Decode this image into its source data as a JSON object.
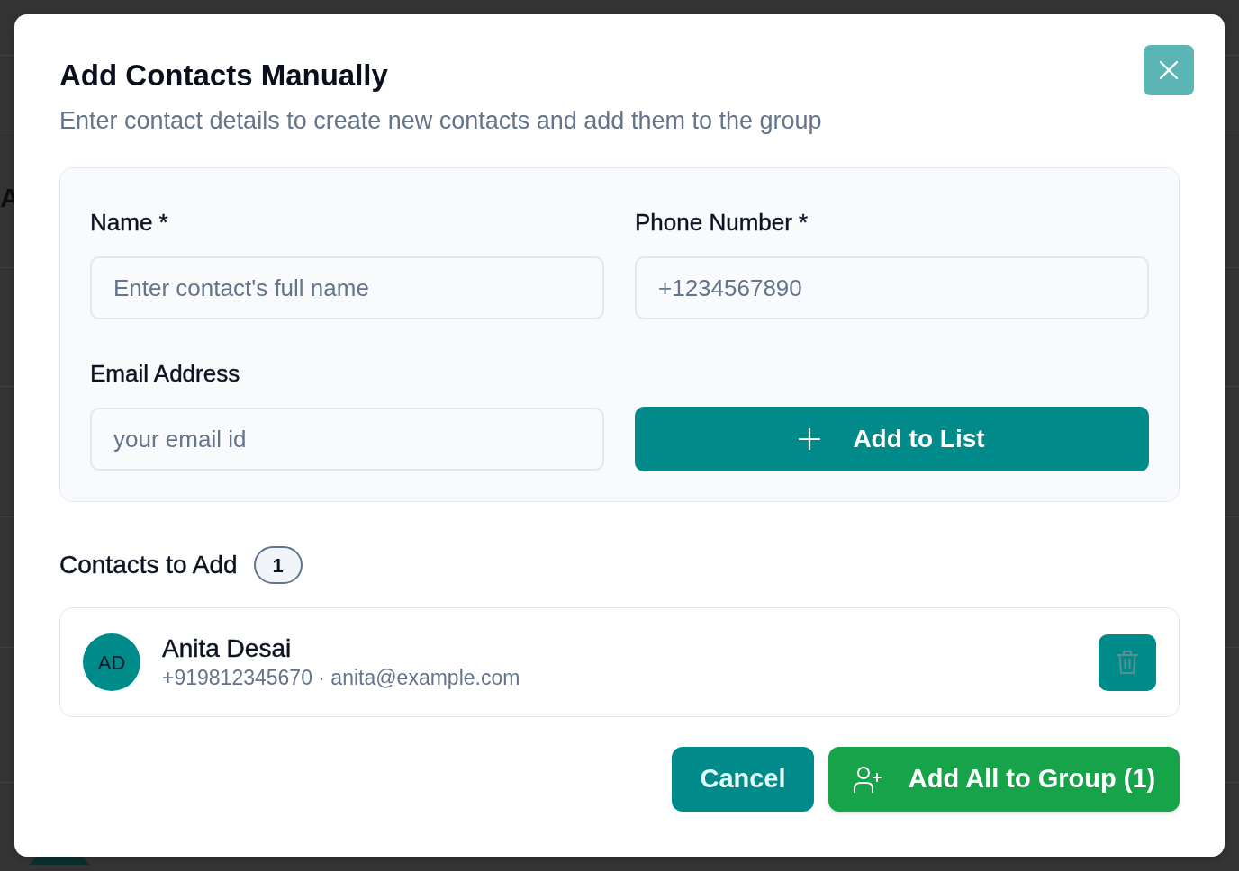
{
  "backdrop": {
    "heading_fragment": "A"
  },
  "dialog": {
    "title": "Add Contacts Manually",
    "subtitle": "Enter contact details to create new contacts and add them to the group"
  },
  "form": {
    "fields": [
      {
        "label": "Name *",
        "placeholder": "Enter contact's full name"
      },
      {
        "label": "Phone Number *",
        "placeholder": "+1234567890"
      },
      {
        "label": "Email Address",
        "placeholder": "your email id"
      }
    ],
    "add_button": "Add to List"
  },
  "contacts_section": {
    "heading": "Contacts to Add",
    "count": "1"
  },
  "contacts": [
    {
      "initials": "AD",
      "name": "Anita Desai",
      "details": "+919812345670 · anita@example.com"
    }
  ],
  "footer": {
    "cancel": "Cancel",
    "submit": "Add All to Group (1)"
  }
}
